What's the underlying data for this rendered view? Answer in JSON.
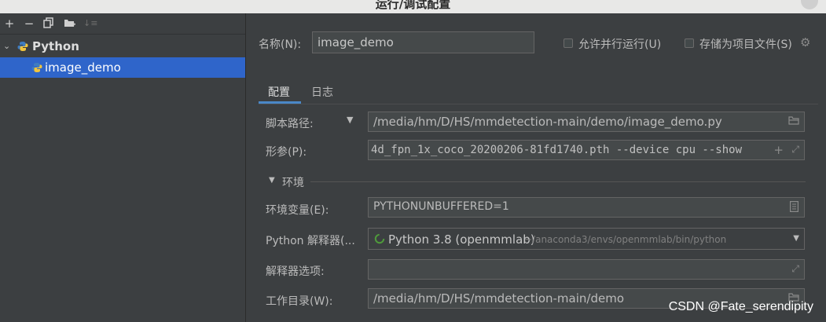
{
  "window": {
    "title": "运行/调试配置"
  },
  "sidebar": {
    "toolbar": [
      "add-icon",
      "remove-icon",
      "copy-icon",
      "folder-add-icon",
      "sort-icon"
    ],
    "tree": [
      {
        "label": "Python",
        "expanded": true
      },
      {
        "label": "image_demo",
        "selected": true
      }
    ]
  },
  "header": {
    "name_label": "名称(N):",
    "name_value": "image_demo",
    "parallel_label": "允许并行运行(U)",
    "store_label": "存储为项目文件(S)"
  },
  "tabs": [
    {
      "label": "配置",
      "active": true
    },
    {
      "label": "日志",
      "active": false
    }
  ],
  "form": {
    "script_label": "脚本路径:",
    "script_value": "/media/hm/D/HS/mmdetection-main/demo/image_demo.py",
    "params_label": "形参(P):",
    "params_value": "4d_fpn_1x_coco_20200206-81fd1740.pth --device cpu --show",
    "env_section": "环境",
    "env_vars_label": "环境变量(E):",
    "env_vars_value": "PYTHONUNBUFFERED=1",
    "interpreter_label": "Python 解释器(...",
    "interpreter_name": "Python 3.8 (openmmlab)",
    "interpreter_path": "~/anaconda3/envs/openmmlab/bin/python",
    "interp_options_label": "解释器选项:",
    "interp_options_value": "",
    "workdir_label": "工作目录(W):",
    "workdir_value": "/media/hm/D/HS/mmdetection-main/demo"
  },
  "watermark": "CSDN @Fate_serendipity",
  "colors": {
    "selection": "#2f65ca",
    "tab_underline": "#4a88c7",
    "background": "#3c3f41",
    "field": "#45494a"
  }
}
